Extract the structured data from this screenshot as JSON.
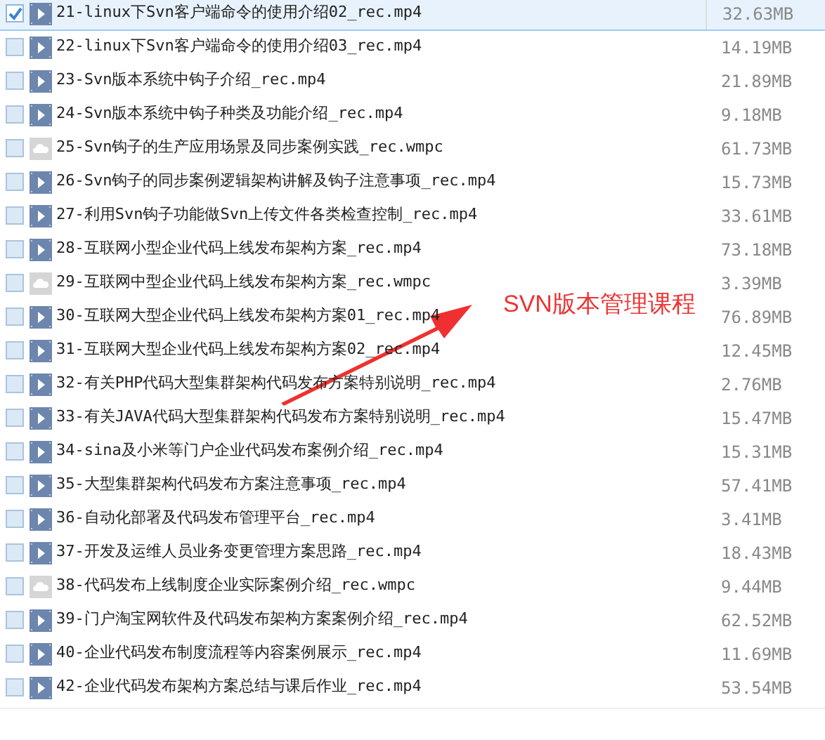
{
  "files": [
    {
      "name": "21-linux下Svn客户端命令的使用介绍02_rec.mp4",
      "size": "32.63MB",
      "kind": "video",
      "checked": true,
      "selected": true
    },
    {
      "name": "22-linux下Svn客户端命令的使用介绍03_rec.mp4",
      "size": "14.19MB",
      "kind": "video",
      "checked": false,
      "selected": false
    },
    {
      "name": "23-Svn版本系统中钩子介绍_rec.mp4",
      "size": "21.89MB",
      "kind": "video",
      "checked": false,
      "selected": false
    },
    {
      "name": "24-Svn版本系统中钩子种类及功能介绍_rec.mp4",
      "size": "9.18MB",
      "kind": "video",
      "checked": false,
      "selected": false
    },
    {
      "name": "25-Svn钩子的生产应用场景及同步案例实践_rec.wmpc",
      "size": "61.73MB",
      "kind": "cloud",
      "checked": false,
      "selected": false
    },
    {
      "name": "26-Svn钩子的同步案例逻辑架构讲解及钩子注意事项_rec.mp4",
      "size": "15.73MB",
      "kind": "video",
      "checked": false,
      "selected": false
    },
    {
      "name": "27-利用Svn钩子功能做Svn上传文件各类检查控制_rec.mp4",
      "size": "33.61MB",
      "kind": "video",
      "checked": false,
      "selected": false
    },
    {
      "name": "28-互联网小型企业代码上线发布架构方案_rec.mp4",
      "size": "73.18MB",
      "kind": "video",
      "checked": false,
      "selected": false
    },
    {
      "name": "29-互联网中型企业代码上线发布架构方案_rec.wmpc",
      "size": "3.39MB",
      "kind": "cloud",
      "checked": false,
      "selected": false
    },
    {
      "name": "30-互联网大型企业代码上线发布架构方案01_rec.mp4",
      "size": "76.89MB",
      "kind": "video",
      "checked": false,
      "selected": false
    },
    {
      "name": "31-互联网大型企业代码上线发布架构方案02_rec.mp4",
      "size": "12.45MB",
      "kind": "video",
      "checked": false,
      "selected": false
    },
    {
      "name": "32-有关PHP代码大型集群架构代码发布方案特别说明_rec.mp4",
      "size": "2.76MB",
      "kind": "video",
      "checked": false,
      "selected": false
    },
    {
      "name": "33-有关JAVA代码大型集群架构代码发布方案特别说明_rec.mp4",
      "size": "15.47MB",
      "kind": "video",
      "checked": false,
      "selected": false
    },
    {
      "name": "34-sina及小米等门户企业代码发布案例介绍_rec.mp4",
      "size": "15.31MB",
      "kind": "video",
      "checked": false,
      "selected": false
    },
    {
      "name": "35-大型集群架构代码发布方案注意事项_rec.mp4",
      "size": "57.41MB",
      "kind": "video",
      "checked": false,
      "selected": false
    },
    {
      "name": "36-自动化部署及代码发布管理平台_rec.mp4",
      "size": "3.41MB",
      "kind": "video",
      "checked": false,
      "selected": false
    },
    {
      "name": "37-开发及运维人员业务变更管理方案思路_rec.mp4",
      "size": "18.43MB",
      "kind": "video",
      "checked": false,
      "selected": false
    },
    {
      "name": "38-代码发布上线制度企业实际案例介绍_rec.wmpc",
      "size": "9.44MB",
      "kind": "cloud",
      "checked": false,
      "selected": false
    },
    {
      "name": "39-门户淘宝网软件及代码发布架构方案案例介绍_rec.mp4",
      "size": "62.52MB",
      "kind": "video",
      "checked": false,
      "selected": false
    },
    {
      "name": "40-企业代码发布制度流程等内容案例展示_rec.mp4",
      "size": "11.69MB",
      "kind": "video",
      "checked": false,
      "selected": false
    },
    {
      "name": "42-企业代码发布架构方案总结与课后作业_rec.mp4",
      "size": "53.54MB",
      "kind": "video",
      "checked": false,
      "selected": false
    }
  ],
  "annotation": {
    "text": "SVN版本管理课程"
  }
}
